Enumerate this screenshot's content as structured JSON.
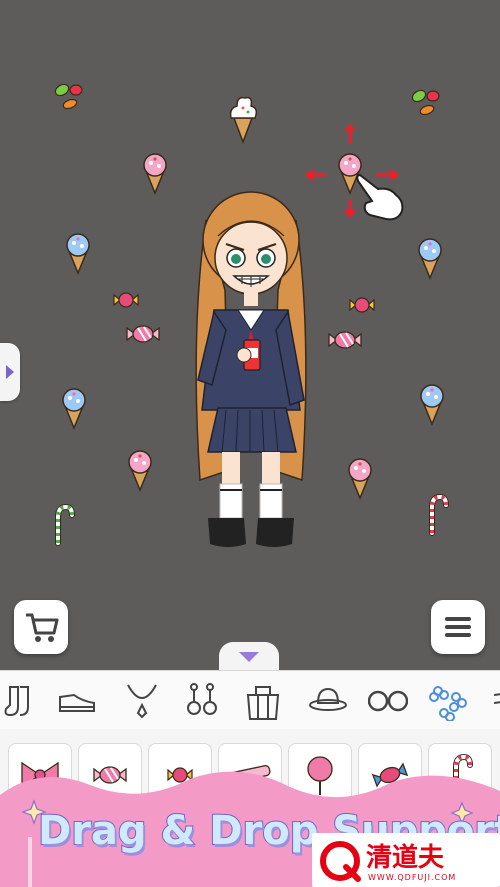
{
  "game": {
    "banner_text": "Drag & Drop Support",
    "watermark_brand": "清道夫",
    "watermark_url": "WWW.QDFUJI.COM"
  },
  "controls": {
    "side_tab_icon": "chevron-right-icon",
    "shop_icon": "cart-icon",
    "menu_icon": "hamburger-icon",
    "drawer_icon": "chevron-down-icon"
  },
  "categories": [
    "socks",
    "shoes",
    "necklace",
    "earrings",
    "bag",
    "hat",
    "glasses",
    "hair-accessory",
    "more"
  ],
  "item_slots": [
    "bow",
    "candy",
    "candy-small",
    "candy-stick",
    "lollipop",
    "wrapped-candy",
    "candy-cane"
  ],
  "colors": {
    "canvas": "#5e5c5a",
    "pink_wave": "#f39ac7",
    "banner_fill": "#cfe9ff",
    "banner_outline": "#6b66c7",
    "drag_arrow": "#e8202a",
    "watermark_red": "#e60012"
  }
}
